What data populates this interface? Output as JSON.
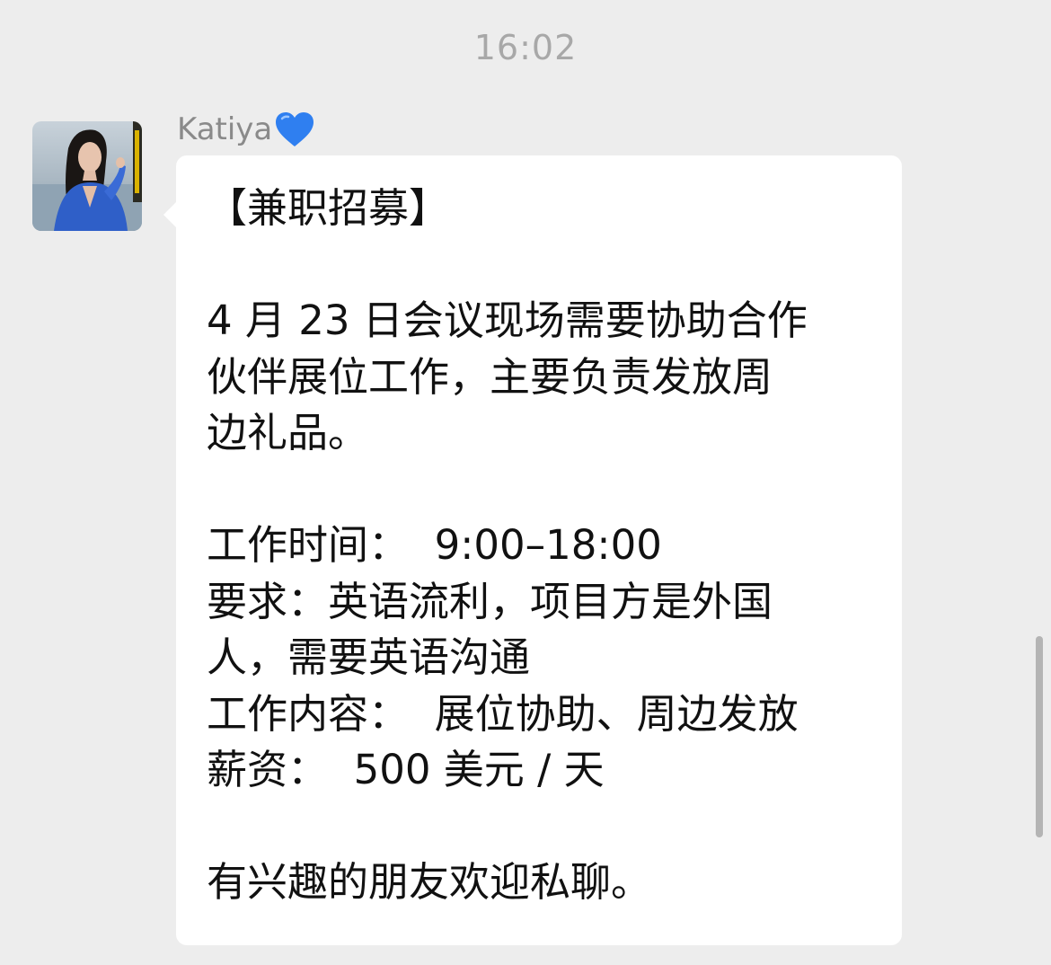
{
  "chat": {
    "timestamp": "16:02",
    "sender_name": "Katiya",
    "sender_emoji_icon": "blue-heart-icon",
    "message_lines": [
      "【兼职招募】",
      "",
      "4 月 23 日会议现场需要协助合作",
      "伙伴展位工作，主要负责发放周",
      "边礼品。",
      "",
      "工作时间：  9:00–18:00",
      "要求：英语流利，项目方是外国",
      "人，需要英语沟通",
      "工作内容：  展位协助、周边发放",
      "薪资：  500 美元 / 天",
      "",
      "有兴趣的朋友欢迎私聊。"
    ]
  },
  "colors": {
    "background": "#ededed",
    "bubble": "#ffffff",
    "timestamp_text": "#a8a8a8",
    "sender_text": "#8a8a8a",
    "message_text": "#111111",
    "heart": "#2f7ff0"
  }
}
